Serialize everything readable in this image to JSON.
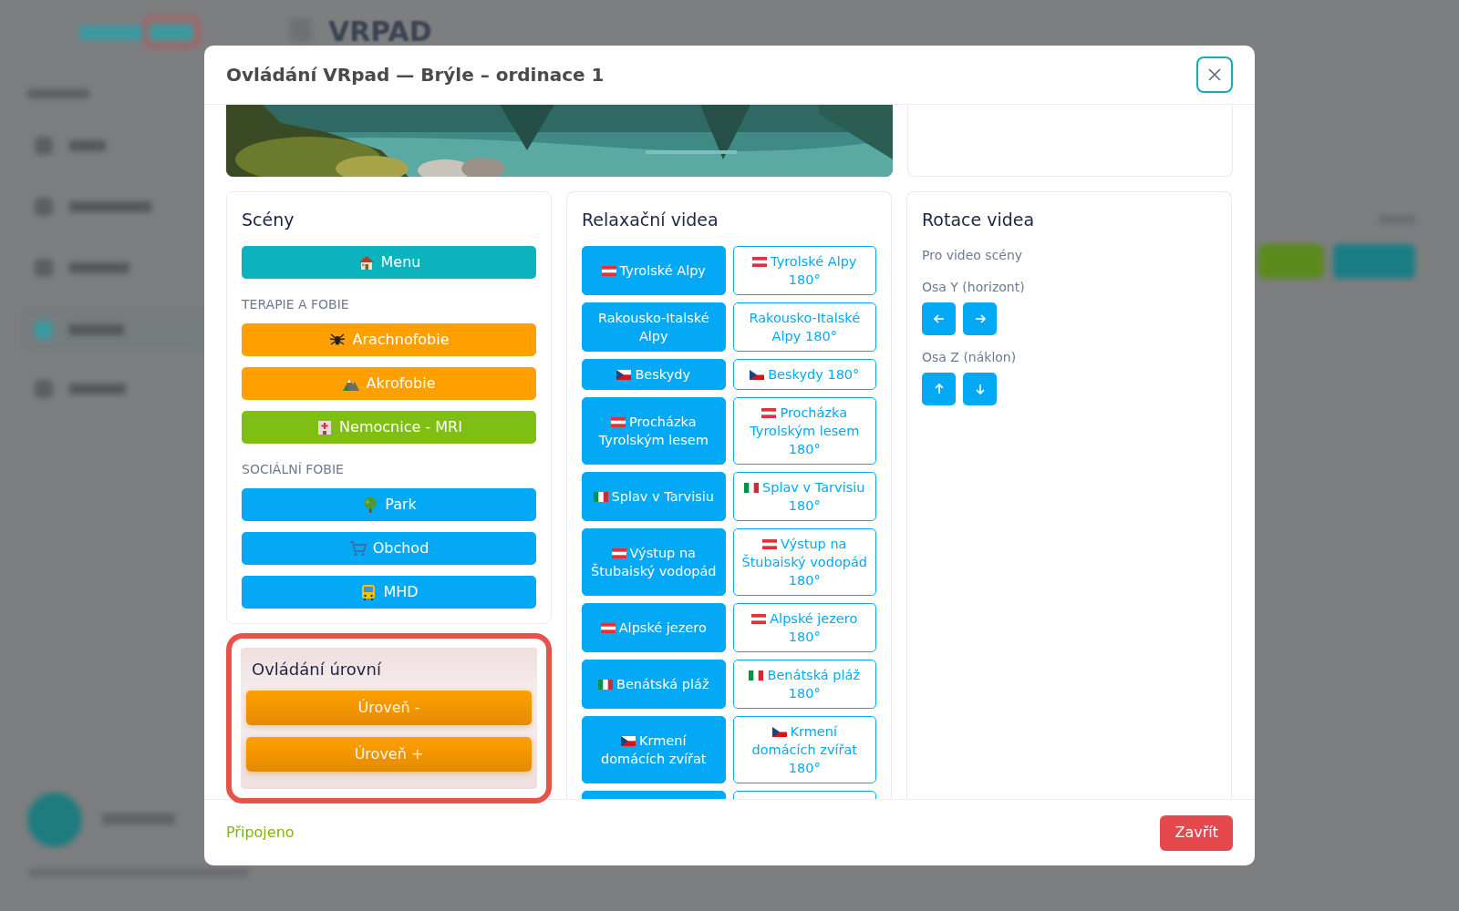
{
  "background": {
    "page_title": "VRPAD",
    "sidebar": [
      {
        "selected": false
      },
      {
        "selected": false
      },
      {
        "selected": false
      },
      {
        "selected": true
      },
      {
        "selected": false
      }
    ]
  },
  "modal": {
    "title": "Ovládání VRpad — Brýle – ordinace 1",
    "scenes": {
      "title": "Scény",
      "groups": [
        {
          "items": [
            {
              "label": "Menu",
              "color": "#0bb3be"
            }
          ]
        },
        {
          "heading": "TERAPIE A FOBIE",
          "items": [
            {
              "label": "Arachnofobie",
              "color": "#ff9f00"
            },
            {
              "label": "Akrofobie",
              "color": "#ff9f00"
            },
            {
              "label": "Nemocnice - MRI",
              "color": "#7fbf13"
            }
          ]
        },
        {
          "heading": "SOCIÁLNÍ FOBIE",
          "items": [
            {
              "label": "Park",
              "color": "#03a9f4"
            },
            {
              "label": "Obchod",
              "color": "#03a9f4"
            },
            {
              "label": "MHD",
              "color": "#03a9f4"
            }
          ]
        }
      ]
    },
    "levels": {
      "title": "Ovládání úrovní",
      "highlighted": true,
      "buttons": [
        {
          "label": "Úroveň -"
        },
        {
          "label": "Úroveň +"
        }
      ]
    },
    "videos": {
      "title": "Relaxační videa",
      "items": [
        {
          "kind": "flat",
          "label": "Tyrolské Alpy"
        },
        {
          "kind": "panorama",
          "label": "Tyrolské Alpy 180°"
        },
        {
          "kind": "flat",
          "label": "Rakousko-Italské Alpy"
        },
        {
          "kind": "panorama",
          "label": "Rakousko-Italské Alpy 180°"
        },
        {
          "kind": "flat",
          "label": "Beskydy"
        },
        {
          "kind": "panorama",
          "label": "Beskydy 180°"
        },
        {
          "kind": "flat",
          "label": "Procházka Tyrolským lesem"
        },
        {
          "kind": "panorama",
          "label": "Procházka Tyrolským lesem 180°"
        },
        {
          "kind": "flat",
          "label": "Splav v Tarvisiu"
        },
        {
          "kind": "panorama",
          "label": "Splav v Tarvisiu 180°"
        },
        {
          "kind": "flat",
          "label": "Výstup na Štubaiský vodopád"
        },
        {
          "kind": "panorama",
          "label": "Výstup na Štubaiský vodopád 180°"
        },
        {
          "kind": "flat",
          "label": "Alpské jezero"
        },
        {
          "kind": "panorama",
          "label": "Alpské jezero 180°"
        },
        {
          "kind": "flat",
          "label": "Benátská pláž"
        },
        {
          "kind": "panorama",
          "label": "Benátská pláž 180°"
        },
        {
          "kind": "flat",
          "label": "Krmení domácích zvířat"
        },
        {
          "kind": "panorama",
          "label": "Krmení domácích zvířat 180°"
        },
        {
          "kind": "flat"
        },
        {
          "kind": "panorama"
        }
      ]
    },
    "rotation": {
      "title": "Rotace videa",
      "subtitle": "Pro video scény",
      "axes": [
        {
          "label": "Osa Y (horizont)",
          "buttons": [
            {
              "kind": "left"
            },
            {
              "kind": "right"
            }
          ]
        },
        {
          "label": "Osa Z (náklon)",
          "buttons": [
            {
              "kind": "up"
            },
            {
              "kind": "down"
            }
          ]
        }
      ]
    },
    "footer": {
      "status": "Připojeno",
      "close_button": "Zavřít"
    }
  }
}
